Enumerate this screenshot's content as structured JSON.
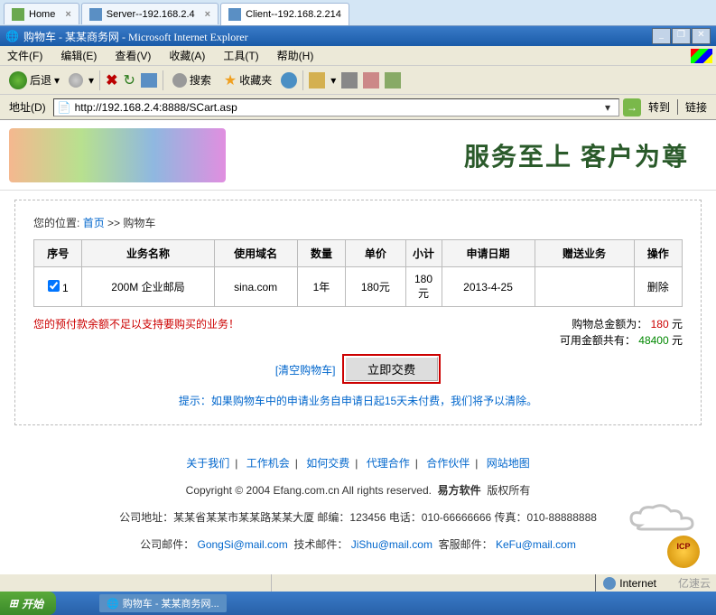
{
  "tabs": {
    "home": "Home",
    "server": "Server--192.168.2.4",
    "client": "Client--192.168.2.214"
  },
  "ie_title": "购物车 - 某某商务网 - Microsoft Internet Explorer",
  "menu": {
    "file": "文件(F)",
    "edit": "编辑(E)",
    "view": "查看(V)",
    "favorites": "收藏(A)",
    "tools": "工具(T)",
    "help": "帮助(H)"
  },
  "toolbar": {
    "back": "后退",
    "search": "搜索",
    "favorites": "收藏夹"
  },
  "address": {
    "label": "地址(D)",
    "url": "http://192.168.2.4:8888/SCart.asp",
    "go": "转到",
    "links": "链接"
  },
  "banner": {
    "slogan": "服务至上 客户为尊"
  },
  "breadcrumb": {
    "label": "您的位置:",
    "home": "首页",
    "sep": ">>",
    "current": "购物车"
  },
  "table": {
    "headers": {
      "seq": "序号",
      "name": "业务名称",
      "domain": "使用域名",
      "qty": "数量",
      "price": "单价",
      "subtotal": "小计",
      "date": "申请日期",
      "bonus": "赠送业务",
      "action": "操作"
    },
    "row": {
      "seq": "1",
      "name": "200M 企业邮局",
      "domain": "sina.com",
      "qty": "1年",
      "price": "180元",
      "subtotal": "180元",
      "date": "2013-4-25",
      "bonus": "",
      "action": "删除"
    }
  },
  "warning": "您的预付款余额不足以支持要购买的业务！",
  "totals": {
    "total_label": "购物总金额为：",
    "total_value": "180",
    "total_unit": "元",
    "avail_label": "可用金额共有：",
    "avail_value": "48400",
    "avail_unit": "元"
  },
  "actions": {
    "clear": "[清空购物车]",
    "pay": "立即交费"
  },
  "tip": "提示：如果购物车中的申请业务自申请日起15天未付费，我们将予以清除。",
  "footer": {
    "links": {
      "about": "关于我们",
      "jobs": "工作机会",
      "pay": "如何交费",
      "agent": "代理合作",
      "partner": "合作伙伴",
      "sitemap": "网站地图"
    },
    "copyright_prefix": "Copyright © 2004 Efang.com.cn All rights reserved.",
    "copyright_suffix": "易方软件",
    "copyright_tail": "版权所有",
    "addr": "公司地址：某某省某某市某某路某某大厦 邮编：123456 电话：010-66666666 传真：010-88888888",
    "emails_label1": "公司邮件：",
    "email1": "GongSi@mail.com",
    "emails_label2": "技术邮件：",
    "email2": "JiShu@mail.com",
    "emails_label3": "客服邮件：",
    "email3": "KeFu@mail.com",
    "icp": "ICP"
  },
  "status": {
    "zone": "Internet"
  },
  "taskbar": {
    "start": "开始",
    "task1": "购物车 - 某某商务网..."
  },
  "watermark": "亿速云"
}
